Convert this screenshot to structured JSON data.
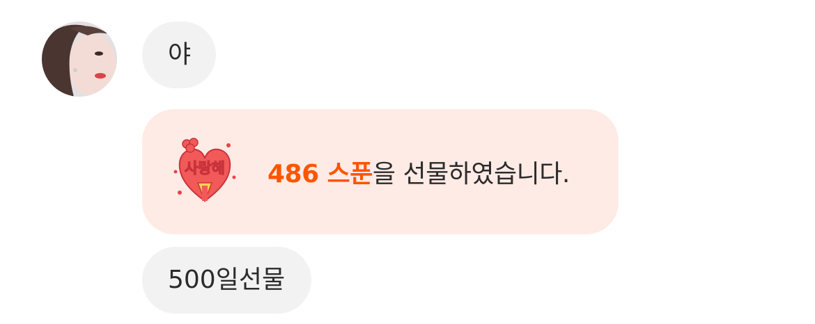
{
  "messages": [
    {
      "type": "text",
      "text": "야"
    },
    {
      "type": "gift",
      "amount_text": "486 스푼",
      "suffix_text": "을 선물하였습니다.",
      "sticker_label": "사랑해"
    },
    {
      "type": "text",
      "text": "500일선물"
    }
  ],
  "colors": {
    "bubble_bg": "#f2f2f2",
    "gift_bg": "#ffebe5",
    "gift_accent": "#ff5500",
    "text": "#2b2b2b"
  }
}
